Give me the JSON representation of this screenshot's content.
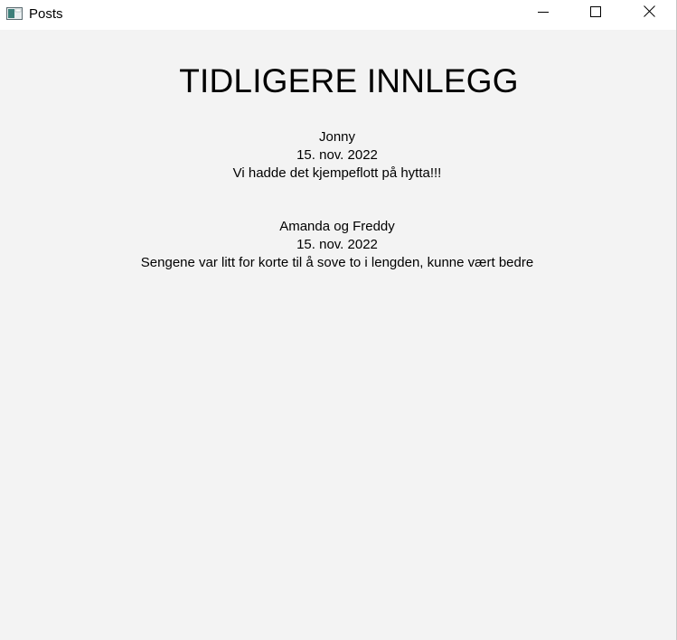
{
  "window": {
    "title": "Posts",
    "icon": "app-window-icon",
    "controls": {
      "minimize_icon": "minimize-icon",
      "maximize_icon": "maximize-icon",
      "close_icon": "close-icon"
    }
  },
  "page": {
    "heading": "TIDLIGERE INNLEGG",
    "posts": [
      {
        "author": "Jonny",
        "date": "15. nov. 2022",
        "text": "Vi hadde det kjempeflott på hytta!!!"
      },
      {
        "author": "Amanda og Freddy",
        "date": "15. nov. 2022",
        "text": "Sengene var litt for korte til å sove to i lengden, kunne vært bedre"
      }
    ]
  },
  "colors": {
    "titlebar": "#ffffff",
    "background": "#f3f3f3",
    "text": "#000000"
  }
}
